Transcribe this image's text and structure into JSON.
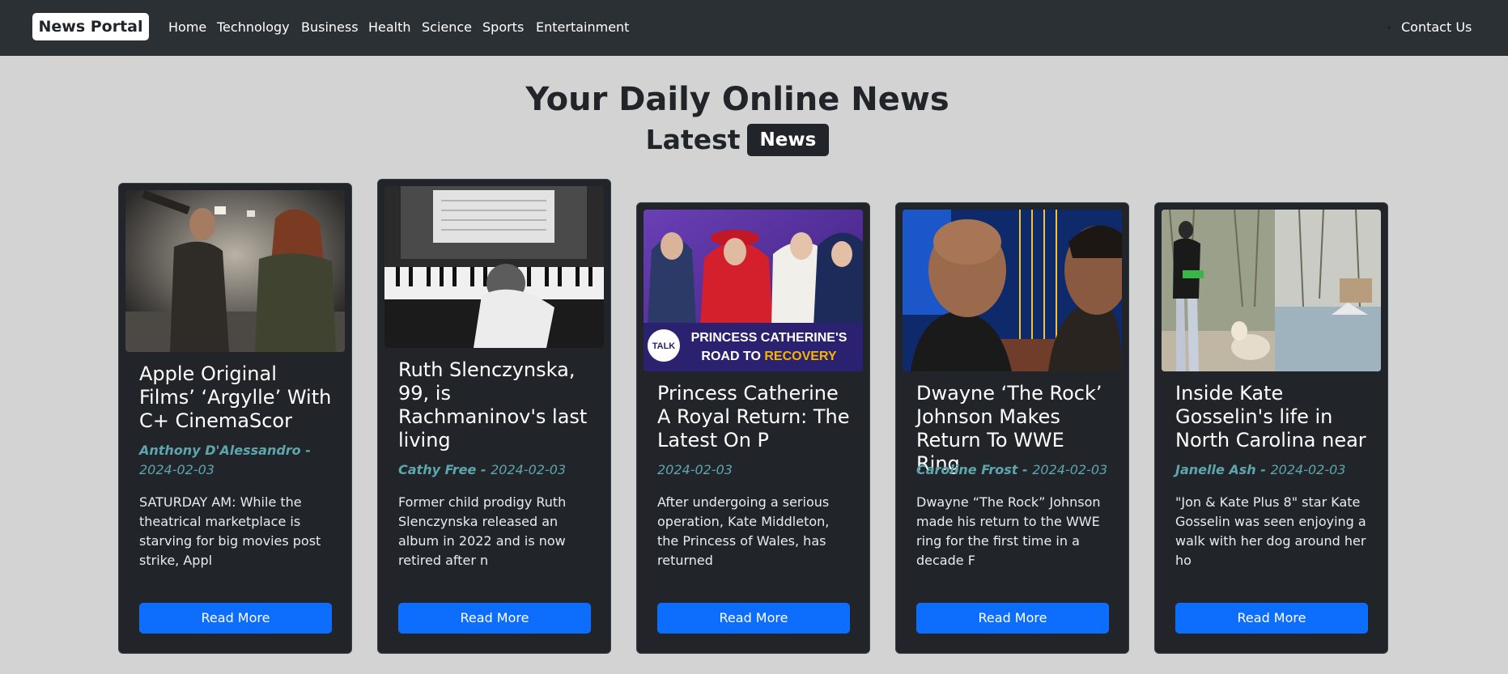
{
  "navbar": {
    "brand": "News Portal",
    "links": [
      "Home",
      "Technology",
      "Business",
      "Health",
      "Science",
      "Sports",
      "Entertainment"
    ],
    "contact": "Contact Us"
  },
  "header": {
    "title": "Your Daily Online News",
    "latest_label": "Latest",
    "latest_badge": "News"
  },
  "cards": [
    {
      "title": "Apple Original Films’ ‘Argylle’ With C+ CinemaScor",
      "author": "Anthony D'Alessandro",
      "separator": " - ",
      "date": "2024-02-03",
      "description": "SATURDAY AM: While the theatrical marketplace is starving for big movies post strike, Appl",
      "button": "Read More"
    },
    {
      "title": "Ruth Slenczynska, 99, is Rachmaninov's last living",
      "author": "Cathy Free",
      "separator": " - ",
      "date": "2024-02-03",
      "description": "Former child prodigy Ruth Slenczynska released an album in 2022 and is now retired after n",
      "button": "Read More"
    },
    {
      "title": "Princess Catherine A Royal Return: The Latest On P",
      "author": "",
      "separator": "",
      "date": "2024-02-03",
      "description": "After undergoing a serious operation, Kate Middleton, the Princess of Wales, has returned",
      "button": "Read More",
      "image_text": {
        "logo": "TALK",
        "line1": "PRINCESS CATHERINE'S",
        "line2a": "ROAD TO ",
        "line2b": "RECOVERY"
      }
    },
    {
      "title": "Dwayne ‘The Rock’ Johnson Makes Return To WWE Ring",
      "author": "Caroline Frost",
      "separator": " - ",
      "date": "2024-02-03",
      "description": "Dwayne “The Rock” Johnson made his return to the WWE ring for the first time in a decade F",
      "button": "Read More"
    },
    {
      "title": "Inside Kate Gosselin's life in North Carolina near",
      "author": "Janelle Ash",
      "separator": " - ",
      "date": "2024-02-03",
      "description": "\"Jon & Kate Plus 8\" star Kate Gosselin was seen enjoying a walk with her dog around her ho",
      "button": "Read More"
    }
  ],
  "colors": {
    "navbar": "#2b3035",
    "page_background": "#d3d3d3",
    "card": "#212529",
    "meta": "#5ea6ad",
    "button": "#0d6efd"
  }
}
